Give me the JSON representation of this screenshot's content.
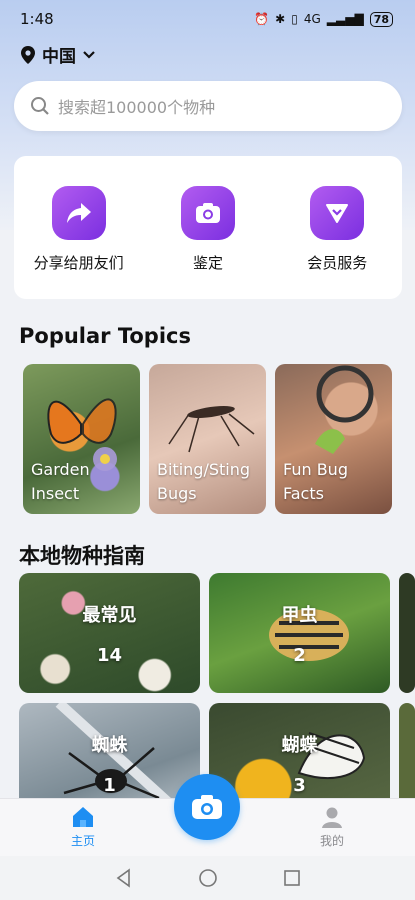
{
  "status": {
    "time": "1:48",
    "battery": "78",
    "signal_text": "4G"
  },
  "location": {
    "label": "中国"
  },
  "search": {
    "placeholder": "搜索超100000个物种"
  },
  "actions": [
    {
      "label": "分享给朋友们",
      "icon": "share-arrow-icon"
    },
    {
      "label": "鉴定",
      "icon": "camera-icon"
    },
    {
      "label": "会员服务",
      "icon": "heart-diamond-icon"
    }
  ],
  "popular": {
    "title": "Popular Topics",
    "items": [
      {
        "line1": "Garden",
        "line2": "Insect"
      },
      {
        "line1": "Biting/Sting",
        "line2": "Bugs"
      },
      {
        "line1": "Fun Bug",
        "line2": "Facts"
      }
    ]
  },
  "guides": {
    "title": "本地物种指南",
    "items": [
      {
        "name": "最常见",
        "count": "14"
      },
      {
        "name": "甲虫",
        "count": "2"
      },
      {
        "name": "蜘蛛",
        "count": "1"
      },
      {
        "name": "蝴蝶",
        "count": "3"
      }
    ]
  },
  "tabs": {
    "home": "主页",
    "mine": "我的"
  },
  "colors": {
    "accent": "#1e8ef2",
    "action_purple": "#8a3be6",
    "tab_active": "#1e8ef2"
  }
}
